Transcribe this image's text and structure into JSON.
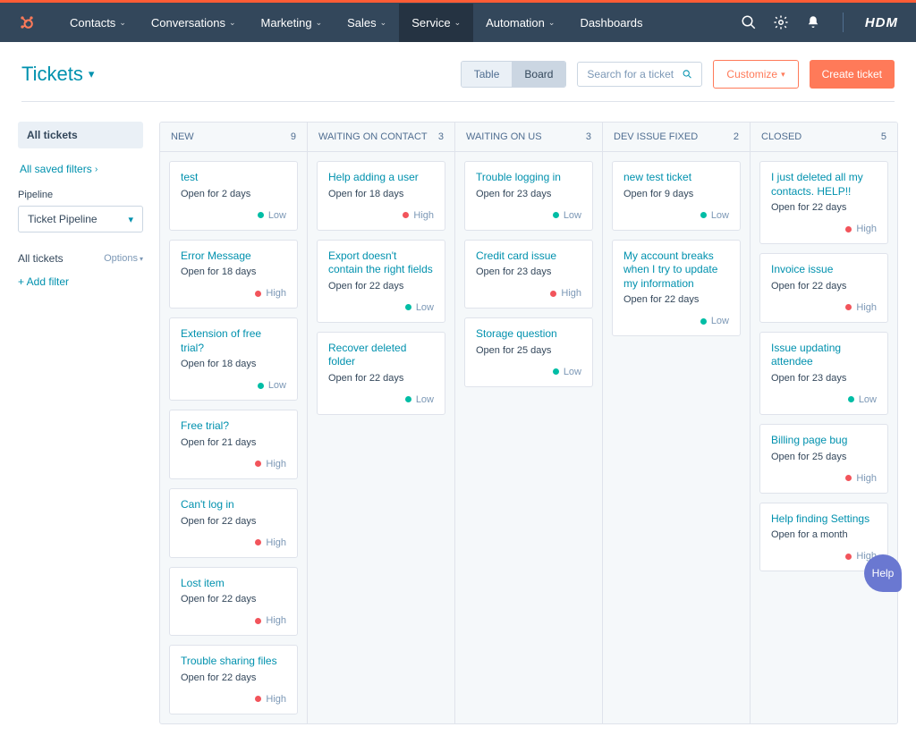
{
  "nav": {
    "items": [
      "Contacts",
      "Conversations",
      "Marketing",
      "Sales",
      "Service",
      "Automation",
      "Dashboards"
    ],
    "active_index": 4,
    "account": "HDM"
  },
  "page": {
    "title": "Tickets",
    "view_toggle": {
      "table": "Table",
      "board": "Board"
    },
    "search_placeholder": "Search for a ticket",
    "customize": "Customize",
    "create": "Create ticket"
  },
  "sidebar": {
    "all_tickets": "All tickets",
    "saved_filters": "All saved filters",
    "pipeline_label": "Pipeline",
    "pipeline_value": "Ticket Pipeline",
    "all_tickets2": "All tickets",
    "options": "Options",
    "add_filter": "+ Add filter"
  },
  "board": {
    "columns": [
      {
        "name": "NEW",
        "count": 9,
        "cards": [
          {
            "title": "test",
            "sub": "Open for 2 days",
            "priority": "Low"
          },
          {
            "title": "Error Message",
            "sub": "Open for 18 days",
            "priority": "High"
          },
          {
            "title": "Extension of free trial?",
            "sub": "Open for 18 days",
            "priority": "Low"
          },
          {
            "title": "Free trial?",
            "sub": "Open for 21 days",
            "priority": "High"
          },
          {
            "title": "Can't log in",
            "sub": "Open for 22 days",
            "priority": "High"
          },
          {
            "title": "Lost item",
            "sub": "Open for 22 days",
            "priority": "High"
          },
          {
            "title": "Trouble sharing files",
            "sub": "Open for 22 days",
            "priority": "High"
          }
        ]
      },
      {
        "name": "WAITING ON CONTACT",
        "count": 3,
        "cards": [
          {
            "title": "Help adding a user",
            "sub": "Open for 18 days",
            "priority": "High"
          },
          {
            "title": "Export doesn't contain the right fields",
            "sub": "Open for 22 days",
            "priority": "Low"
          },
          {
            "title": "Recover deleted folder",
            "sub": "Open for 22 days",
            "priority": "Low"
          }
        ]
      },
      {
        "name": "WAITING ON US",
        "count": 3,
        "cards": [
          {
            "title": "Trouble logging in",
            "sub": "Open for 23 days",
            "priority": "Low"
          },
          {
            "title": "Credit card issue",
            "sub": "Open for 23 days",
            "priority": "High"
          },
          {
            "title": "Storage question",
            "sub": "Open for 25 days",
            "priority": "Low"
          }
        ]
      },
      {
        "name": "DEV ISSUE FIXED",
        "count": 2,
        "cards": [
          {
            "title": "new test ticket",
            "sub": "Open for 9 days",
            "priority": "Low"
          },
          {
            "title": "My account breaks when I try to update my information",
            "sub": "Open for 22 days",
            "priority": "Low"
          }
        ]
      },
      {
        "name": "CLOSED",
        "count": 5,
        "cards": [
          {
            "title": "I just deleted all my contacts. HELP!!",
            "sub": "Open for 22 days",
            "priority": "High"
          },
          {
            "title": "Invoice issue",
            "sub": "Open for 22 days",
            "priority": "High"
          },
          {
            "title": "Issue updating attendee",
            "sub": "Open for 23 days",
            "priority": "Low"
          },
          {
            "title": "Billing page bug",
            "sub": "Open for 25 days",
            "priority": "High"
          },
          {
            "title": "Help finding Settings",
            "sub": "Open for a month",
            "priority": "High"
          }
        ]
      }
    ]
  },
  "help": "Help"
}
